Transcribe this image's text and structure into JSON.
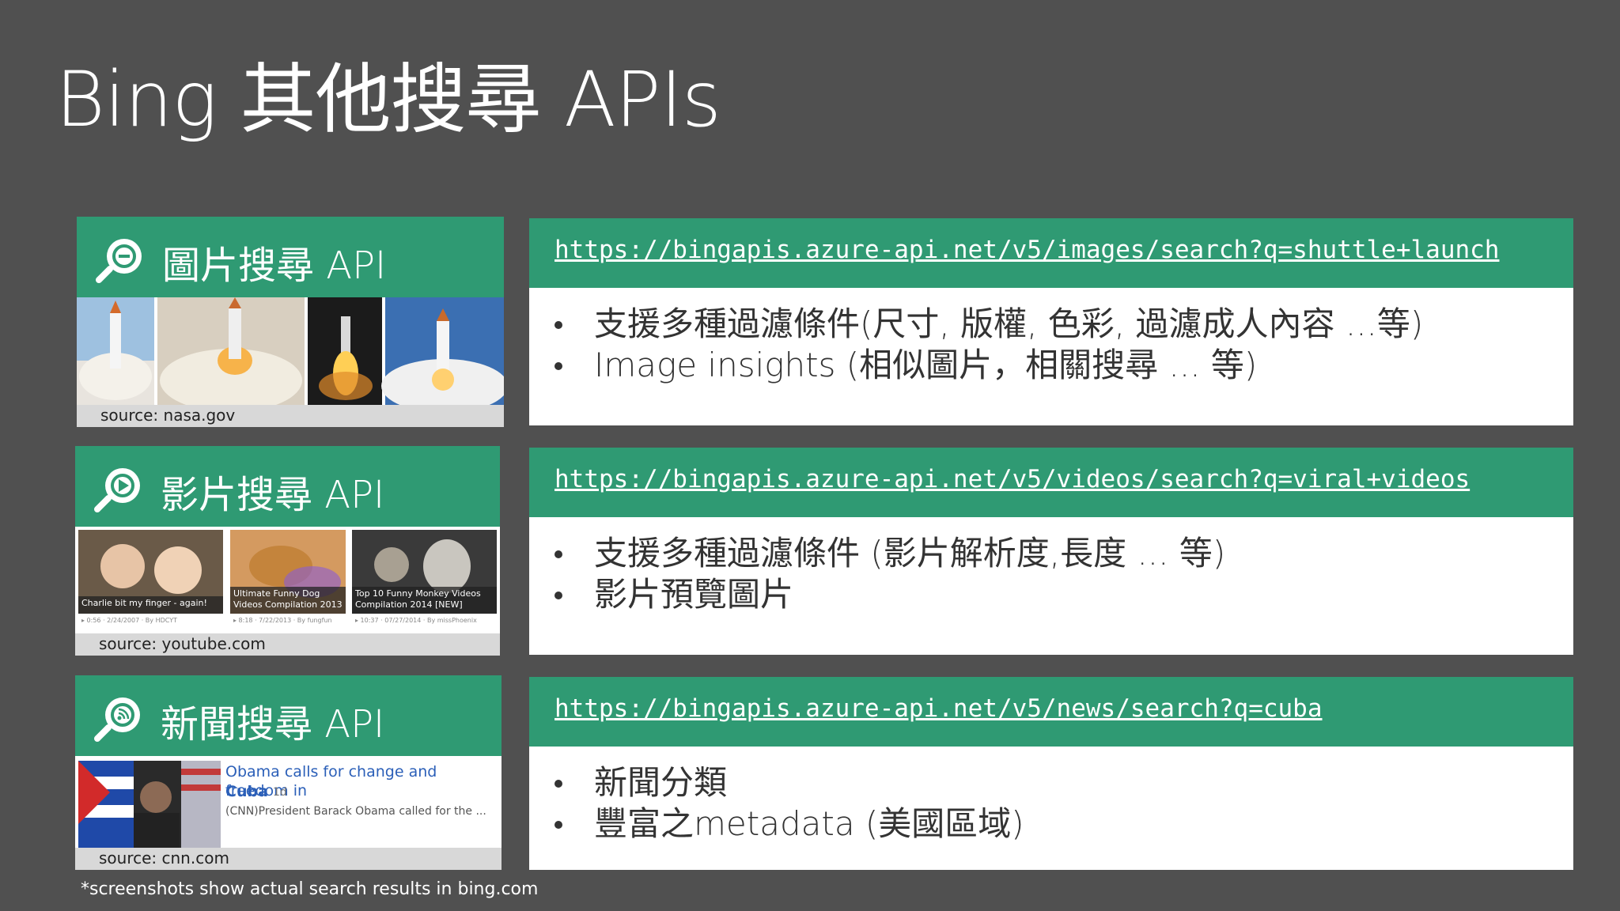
{
  "title": "Bing 其他搜尋 APIs",
  "cards": [
    {
      "label": "圖片搜尋 API",
      "icon": "image-search-icon",
      "source": "source: nasa.gov",
      "url": "https://bingapis.azure-api.net/v5/images/search?q=shuttle+launch",
      "bullets": [
        "支援多種過濾條件(尺寸, 版權, 色彩, 過濾成人內容 ...等)",
        "Image insights (相似圖片，相關搜尋 ... 等)"
      ]
    },
    {
      "label": "影片搜尋 API",
      "icon": "video-search-icon",
      "source": "source: youtube.com",
      "url": "https://bingapis.azure-api.net/v5/videos/search?q=viral+videos",
      "bullets": [
        "支援多種過濾條件 (影片解析度,長度 ... 等)",
        "影片預覽圖片"
      ],
      "thumbs": [
        {
          "caption": "Charlie bit my finger - again!",
          "meta": "▸ 0:56 · 2/24/2007 · By HDCYT"
        },
        {
          "caption": "Ultimate Funny Dog Videos Compilation 2013",
          "meta": "▸ 8:18 · 7/22/2013 · By fungfun"
        },
        {
          "caption": "Top 10 Funny Monkey Videos Compilation 2014 [NEW]",
          "meta": "▸ 10:37 · 07/27/2014 · By missPhoenix"
        }
      ]
    },
    {
      "label": "新聞搜尋 API",
      "icon": "news-search-icon",
      "source": "source: cnn.com",
      "url": "https://bingapis.azure-api.net/v5/news/search?q=cuba",
      "bullets": [
        "新聞分類",
        "豐富之metadata (美國區域)"
      ],
      "news": {
        "headline": "Obama calls for change and freedom in",
        "query": "Cuba",
        "age": "1d",
        "snippet": "(CNN)President Barack Obama called for the ..."
      }
    }
  ],
  "footnote": "*screenshots show actual search results in bing.com",
  "colors": {
    "accent": "#2f9a73",
    "background": "#505050"
  }
}
